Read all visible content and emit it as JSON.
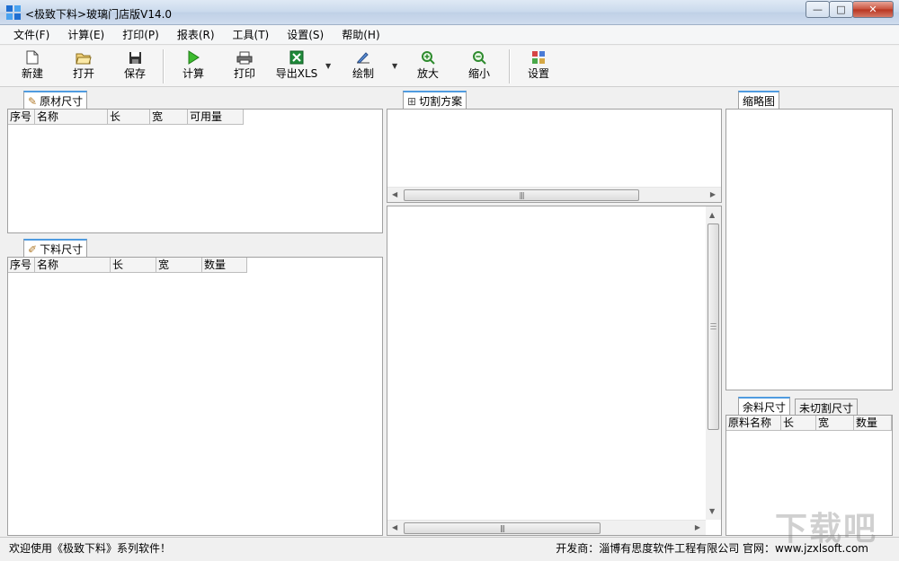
{
  "window": {
    "title": "<极致下料>玻璃门店版V14.0",
    "minimize_glyph": "—",
    "maximize_glyph": "□",
    "close_glyph": "✕"
  },
  "menu": [
    "文件(F)",
    "计算(E)",
    "打印(P)",
    "报表(R)",
    "工具(T)",
    "设置(S)",
    "帮助(H)"
  ],
  "toolbar": {
    "new": "新建",
    "open": "打开",
    "save": "保存",
    "calculate": "计算",
    "print": "打印",
    "export_xls": "导出XLS",
    "draw": "绘制",
    "zoom_in": "放大",
    "zoom_out": "缩小",
    "settings": "设置"
  },
  "raw_material": {
    "tab": "原材尺寸",
    "columns": [
      "序号",
      "名称",
      "长",
      "宽",
      "可用量"
    ]
  },
  "cut_material": {
    "tab": "下料尺寸",
    "columns": [
      "序号",
      "名称",
      "长",
      "宽",
      "数量"
    ]
  },
  "cutting_plan": {
    "tab": "切割方案"
  },
  "thumbnail": {
    "tab": "缩略图"
  },
  "remainder": {
    "tabs": [
      "余料尺寸",
      "未切割尺寸"
    ],
    "columns": [
      "原料名称",
      "长",
      "宽",
      "数量"
    ]
  },
  "status": {
    "welcome": "欢迎使用《极致下料》系列软件！",
    "developer": "开发商：淄博有思度软件工程有限公司   官网：www.jzxlsoft.com"
  },
  "watermark": "下载吧",
  "colors": {
    "tab_accent": "#4f9be0",
    "close_button": "#c8503b"
  }
}
